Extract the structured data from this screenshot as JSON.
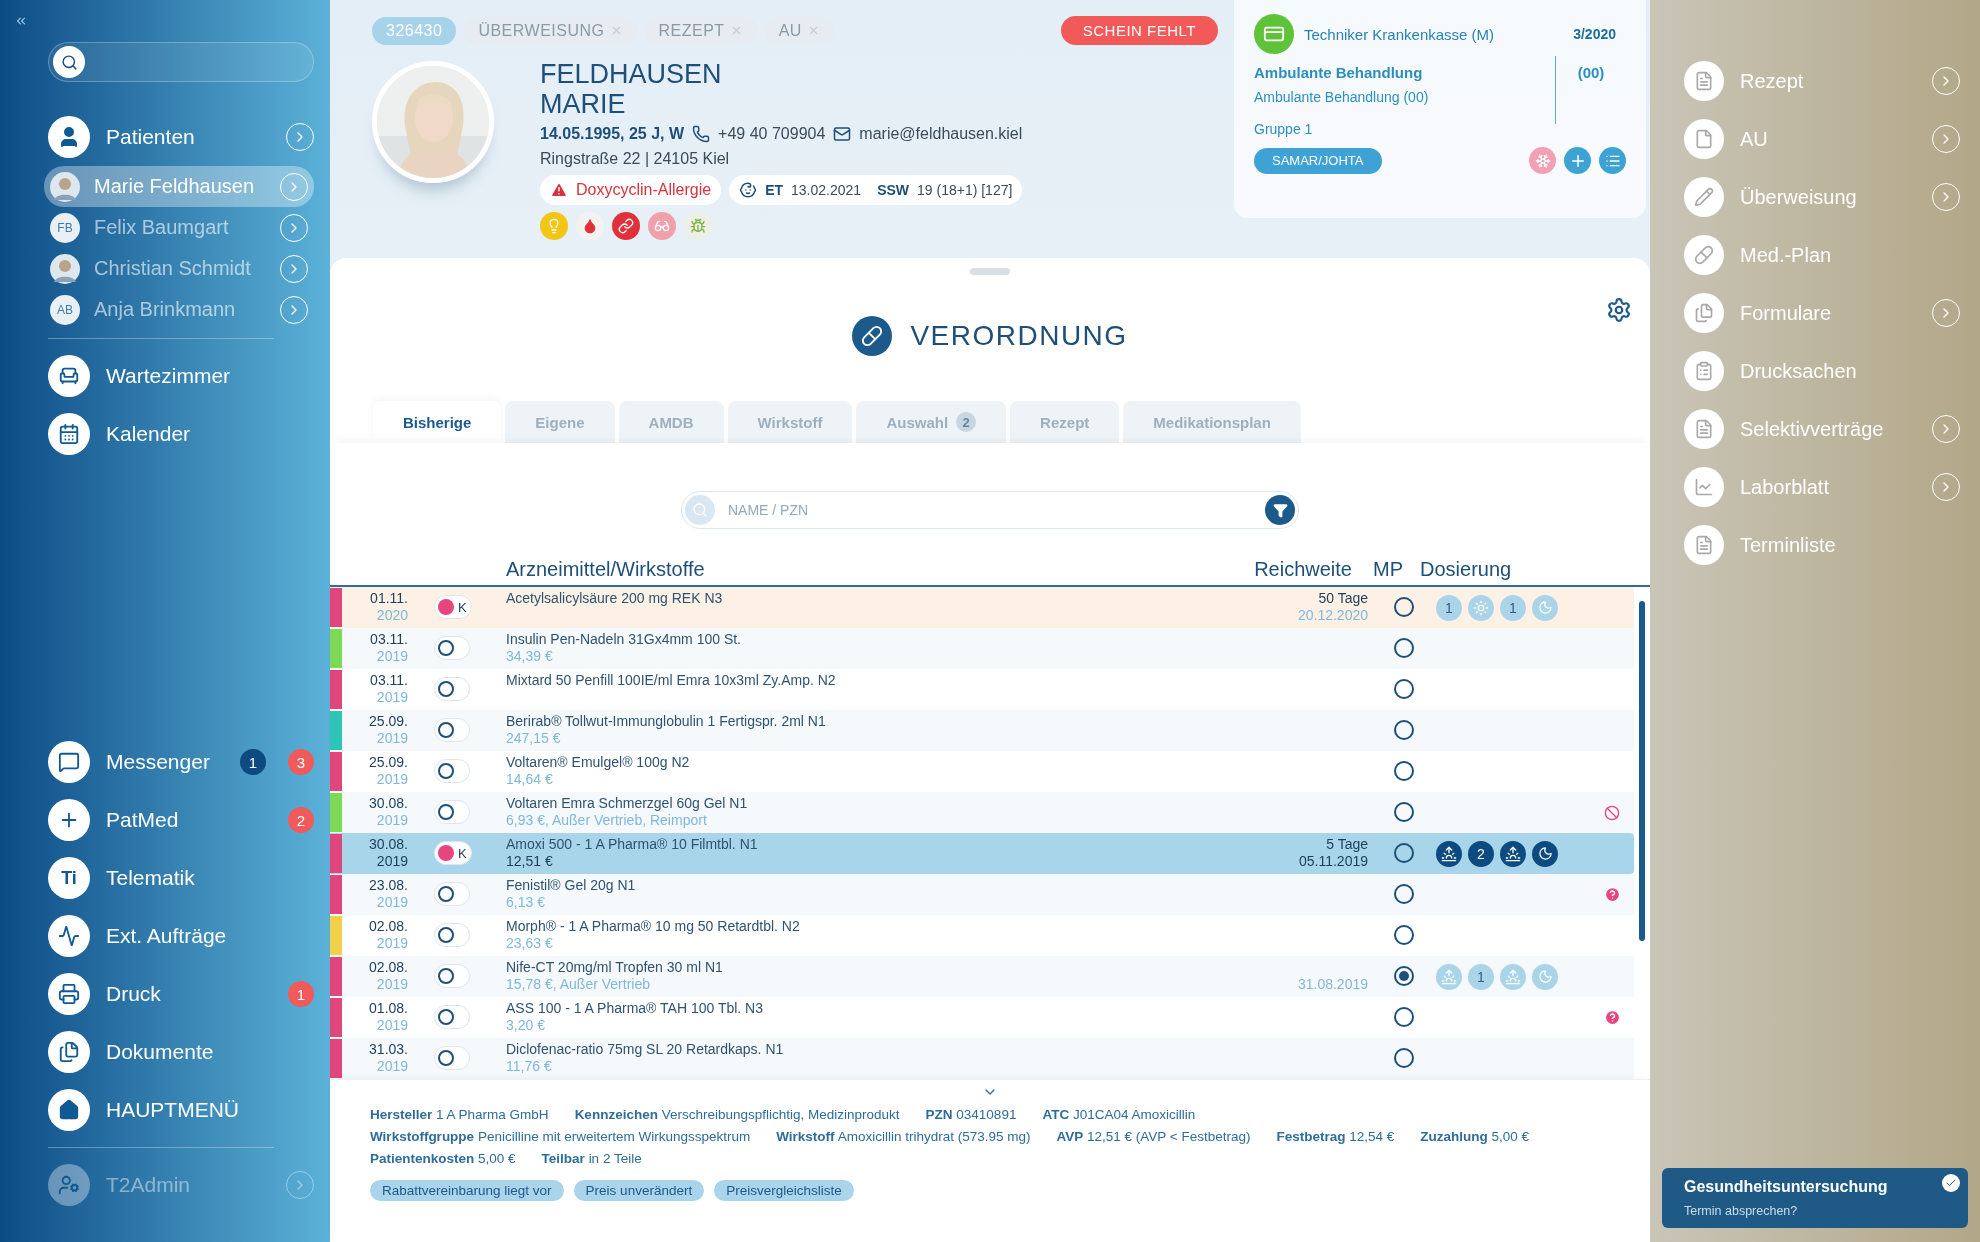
{
  "sidebar": {
    "patients_label": "Patienten",
    "patients": [
      {
        "name": "Marie Feldhausen",
        "selected": true
      },
      {
        "name": "Felix Baumgart",
        "kind": "initials",
        "initials": "FB",
        "selected": false
      },
      {
        "name": "Christian Schmidt",
        "selected": false
      },
      {
        "name": "Anja Brinkmann",
        "kind": "initials",
        "initials": "AB",
        "selected": false
      }
    ],
    "top_items": [
      {
        "label": "Wartezimmer"
      },
      {
        "label": "Kalender"
      }
    ],
    "bottom_items": [
      {
        "label": "Messenger",
        "badges": [
          {
            "text": "1",
            "color": "#0d4a80"
          },
          {
            "text": "3",
            "color": "#f05a5a"
          }
        ]
      },
      {
        "label": "PatMed",
        "badges": [
          {
            "text": "2",
            "color": "#f05a5a"
          }
        ]
      },
      {
        "label": "Telematik",
        "icon_text": "Ti"
      },
      {
        "label": "Ext. Aufträge"
      },
      {
        "label": "Druck",
        "badges": [
          {
            "text": "1",
            "color": "#f05a5a"
          }
        ]
      },
      {
        "label": "Dokumente"
      },
      {
        "label": "HAUPTMENÜ"
      }
    ],
    "admin": {
      "label": "T2Admin",
      "disabled": true
    }
  },
  "header": {
    "tags": [
      {
        "label": "326430",
        "kind": "id"
      },
      {
        "label": "ÜBERWEISUNG",
        "kind": "closable"
      },
      {
        "label": "REZEPT",
        "kind": "closable"
      },
      {
        "label": "AU",
        "kind": "closable"
      }
    ],
    "alert": "SCHEIN FEHLT",
    "last_name": "FELDHAUSEN",
    "first_name": "MARIE",
    "birth": "14.05.1995, 25 J, W",
    "phone": "+49 40 709904",
    "email": "marie@feldhausen.kiel",
    "address": "Ringstraße 22 | 24105 Kiel",
    "allergy": "Doxycyclin-Allergie",
    "pregnancy": {
      "et_label": "ET",
      "et": "13.02.2021",
      "ssw_label": "SSW",
      "ssw": "19 (18+1) [127]"
    }
  },
  "insurance": {
    "name": "Techniker Krankenkasse (M)",
    "quarter": "3/2020",
    "treatment_title": "Ambulante Behandlung",
    "code": "(00)",
    "treatment": "Ambulante Behandlung (00)",
    "group": "Gruppe 1",
    "button": "SAMAR/JOHTA"
  },
  "verordnung": {
    "title": "VERORDNUNG",
    "tabs": [
      {
        "label": "Bisherige",
        "selected": true
      },
      {
        "label": "Eigene",
        "selected": false
      },
      {
        "label": "AMDB",
        "selected": false
      },
      {
        "label": "Wirkstoff",
        "selected": false
      },
      {
        "label": "Auswahl",
        "count": "2",
        "selected": false
      },
      {
        "label": "Rezept",
        "selected": false
      },
      {
        "label": "Medikationsplan",
        "selected": false
      }
    ],
    "search_placeholder": "NAME / PZN",
    "columns": [
      "Arzneimittel/Wirkstoffe",
      "Reichweite",
      "MP",
      "Dosierung"
    ],
    "rows": [
      {
        "date": "01.11.",
        "year": "2020",
        "color": "#e0457b",
        "toggle": {
          "on": true,
          "label": "K"
        },
        "name": "Acetylsalicylsäure 200 mg REK N3",
        "range_days": "50 Tage",
        "range_until": "20.12.2020",
        "mp": false,
        "dosage": [
          {
            "kind": "count",
            "text": "1",
            "active": false
          },
          {
            "kind": "sun",
            "active": false
          },
          {
            "kind": "count",
            "text": "1",
            "active": false
          },
          {
            "kind": "moon",
            "active": false
          }
        ],
        "selected": false,
        "flagged": true
      },
      {
        "date": "03.11.",
        "year": "2019",
        "color": "#7ed957",
        "toggle": {
          "on": false
        },
        "name": "Insulin Pen-Nadeln 31Gx4mm 100 St.",
        "info": "34,39 €",
        "mp": false,
        "selected": false,
        "flagged": false
      },
      {
        "date": "03.11.",
        "year": "2019",
        "color": "#e0457b",
        "toggle": {
          "on": false
        },
        "name": "Mixtard 50 Penfill 100IE/ml Emra 10x3ml Zy.Amp. N2",
        "mp": false,
        "selected": false,
        "flagged": false
      },
      {
        "date": "25.09.",
        "year": "2019",
        "color": "#2ec4b6",
        "toggle": {
          "on": false
        },
        "name": "Berirab® Tollwut-Immunglobulin 1 Fertigspr. 2ml N1",
        "info": "247,15 €",
        "mp": false,
        "selected": false,
        "flagged": false
      },
      {
        "date": "25.09.",
        "year": "2019",
        "color": "#e0457b",
        "toggle": {
          "on": false
        },
        "name": "Voltaren® Emulgel® 100g N2",
        "info": "14,64 €",
        "mp": false,
        "selected": false,
        "flagged": false
      },
      {
        "date": "30.08.",
        "year": "2019",
        "color": "#7ed957",
        "toggle": {
          "on": false
        },
        "name": "Voltaren Emra Schmerzgel 60g Gel N1",
        "info": "6,93 €, Außer Vertrieb, Reimport",
        "mp": false,
        "marker": {
          "kind": "blocked"
        },
        "selected": false,
        "flagged": false
      },
      {
        "date": "30.08.",
        "year": "2019",
        "color": "#e0457b",
        "toggle": {
          "on": true,
          "label": "K"
        },
        "name": "Amoxi 500 - 1 A Pharma® 10 Filmtbl. N1",
        "info": "12,51 €",
        "range_days": "5 Tage",
        "range_until": "05.11.2019",
        "mp": false,
        "dosage": [
          {
            "kind": "sunrise",
            "active": true
          },
          {
            "kind": "count",
            "text": "2",
            "active": true
          },
          {
            "kind": "sunrise",
            "active": true
          },
          {
            "kind": "moon",
            "active": true
          }
        ],
        "selected": true,
        "flagged": false
      },
      {
        "date": "23.08.",
        "year": "2019",
        "color": "#e0457b",
        "toggle": {
          "on": false
        },
        "name": "Fenistil® Gel 20g N1",
        "info": "6,13 €",
        "mp": false,
        "marker": {
          "kind": "question"
        },
        "selected": false,
        "flagged": false
      },
      {
        "date": "02.08.",
        "year": "2019",
        "color": "#f2d04b",
        "toggle": {
          "on": false
        },
        "name": "Morph® - 1 A Pharma® 10 mg 50 Retardtbl. N2",
        "info": "23,63 €",
        "mp": false,
        "selected": false,
        "flagged": false
      },
      {
        "date": "02.08.",
        "year": "2019",
        "color": "#e0457b",
        "toggle": {
          "on": false
        },
        "name": "Nife-CT 20mg/ml Tropfen 30 ml N1",
        "info": "15,78 €, Außer Vertrieb",
        "range_until": "31.08.2019",
        "mp": true,
        "dosage": [
          {
            "kind": "sunrise",
            "active": false
          },
          {
            "kind": "count",
            "text": "1",
            "active": false
          },
          {
            "kind": "sunrise",
            "active": false
          },
          {
            "kind": "moon",
            "active": false
          }
        ],
        "selected": false,
        "flagged": false
      },
      {
        "date": "01.08.",
        "year": "2019",
        "color": "#e0457b",
        "toggle": {
          "on": false
        },
        "name": "ASS 100 - 1 A Pharma® TAH 100 Tbl. N3",
        "info": "3,20 €",
        "mp": false,
        "marker": {
          "kind": "question"
        },
        "selected": false,
        "flagged": false
      },
      {
        "date": "31.03.",
        "year": "2019",
        "color": "#e0457b",
        "toggle": {
          "on": false
        },
        "name": "Diclofenac-ratio 75mg SL 20 Retardkaps. N1",
        "info": "11,76 €",
        "mp": false,
        "selected": false,
        "flagged": false
      }
    ],
    "details": [
      [
        {
          "label": "Hersteller",
          "value": "1 A Pharma GmbH"
        },
        {
          "label": "Kennzeichen",
          "value": "Verschreibungspflichtig, Medizinprodukt"
        },
        {
          "label": "PZN",
          "value": "03410891"
        },
        {
          "label": "ATC",
          "value": "J01CA04 Amoxicillin"
        }
      ],
      [
        {
          "label": "Wirkstoffgruppe",
          "value": "Penicilline mit erweitertem Wirkungsspektrum"
        },
        {
          "label": "Wirkstoff",
          "value": "Amoxicillin trihydrat (573.95 mg)"
        },
        {
          "label": "AVP",
          "value": "12,51 € (AVP < Festbetrag)"
        },
        {
          "label": "Festbetrag",
          "value": "12,54 €"
        },
        {
          "label": "Zuzahlung",
          "value": "5,00 €"
        }
      ],
      [
        {
          "label": "Patientenkosten",
          "value": "5,00 €"
        },
        {
          "label": "Teilbar",
          "value": "in 2 Teile"
        }
      ]
    ],
    "chips": [
      "Rabattvereinbarung liegt vor",
      "Preis unverändert",
      "Preisvergleichsliste"
    ]
  },
  "right_sidebar": [
    {
      "label": "Rezept",
      "has_arrow": true
    },
    {
      "label": "AU",
      "has_arrow": true
    },
    {
      "label": "Überweisung",
      "has_arrow": true
    },
    {
      "label": "Med.-Plan",
      "has_arrow": false
    },
    {
      "label": "Formulare",
      "has_arrow": true
    },
    {
      "label": "Drucksachen",
      "has_arrow": false
    },
    {
      "label": "Selektivverträge",
      "has_arrow": true
    },
    {
      "label": "Laborblatt",
      "has_arrow": true
    },
    {
      "label": "Terminliste",
      "has_arrow": false
    }
  ],
  "notification": {
    "title": "Gesundheitsuntersuchung",
    "text": "Termin absprechen?"
  }
}
